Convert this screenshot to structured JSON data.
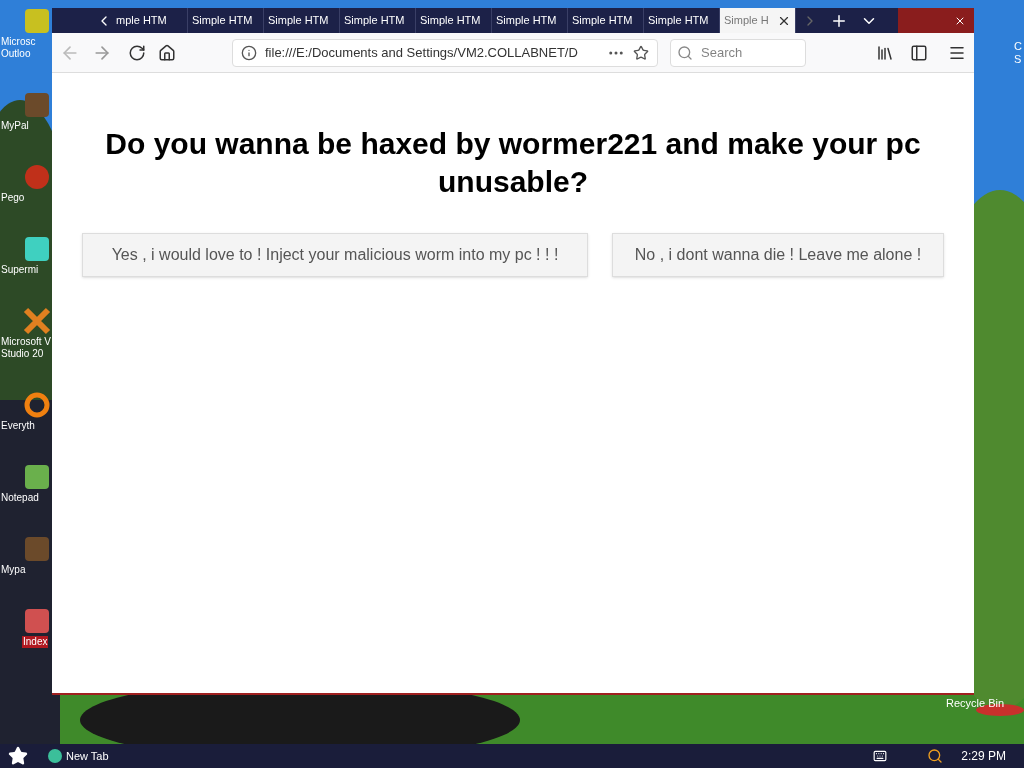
{
  "desktop": {
    "icons": [
      {
        "label": "Microsc Outloo",
        "kind": "outlook"
      },
      {
        "label": "MyPal",
        "kind": "animal"
      },
      {
        "label": "Pego",
        "kind": "ball"
      },
      {
        "label": "Supermi",
        "kind": "cloud"
      },
      {
        "label": "Microsoft V Studio 20",
        "kind": "cross"
      },
      {
        "label": "Everyth",
        "kind": "ring"
      },
      {
        "label": "Notepad",
        "kind": "notepad"
      },
      {
        "label": "Mypa",
        "kind": "animal"
      },
      {
        "label": "Index",
        "kind": "index",
        "selected": true
      }
    ],
    "right_icons": [
      {
        "label": "C S"
      },
      {
        "label": "Recycle Bin"
      }
    ]
  },
  "browser": {
    "tabs": [
      {
        "label": "mple HTM",
        "selected": false
      },
      {
        "label": "Simple HTM",
        "selected": false
      },
      {
        "label": "Simple HTM",
        "selected": false
      },
      {
        "label": "Simple HTM",
        "selected": false
      },
      {
        "label": "Simple HTM",
        "selected": false
      },
      {
        "label": "Simple HTM",
        "selected": false
      },
      {
        "label": "Simple HTM",
        "selected": false
      },
      {
        "label": "Simple HTM",
        "selected": false
      },
      {
        "label": "Simple H",
        "selected": true
      }
    ],
    "address": "file:///E:/Documents and Settings/VM2.COLLABNET/D",
    "search": {
      "placeholder": "Search"
    },
    "page": {
      "heading": "Do you wanna be haxed by wormer221 and make your pc unusable?",
      "buttons": [
        "Yes , i would love to ! Inject your malicious worm into my pc ! ! !",
        "No , i dont wanna die ! Leave me alone !"
      ]
    }
  },
  "taskbar": {
    "task": "New Tab",
    "clock": "2:29 PM"
  }
}
